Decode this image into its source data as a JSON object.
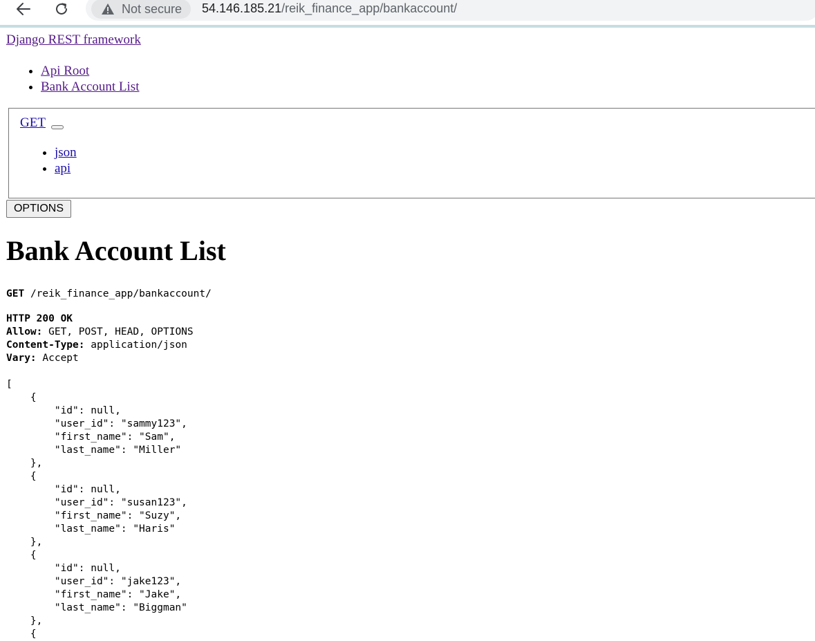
{
  "browser": {
    "security_label": "Not secure",
    "url_host": "54.146.185.21",
    "url_path": "/reik_finance_app/bankaccount/"
  },
  "brand": "Django REST framework",
  "breadcrumbs": [
    "Api Root",
    "Bank Account List"
  ],
  "get_menu": {
    "label": "GET",
    "formats": [
      "json",
      "api"
    ]
  },
  "options_button": "OPTIONS",
  "page_title": "Bank Account List",
  "request": {
    "method": "GET",
    "path": "/reik_finance_app/bankaccount/"
  },
  "response": {
    "status": "HTTP 200 OK",
    "headers": [
      {
        "name": "Allow:",
        "value": "GET, POST, HEAD, OPTIONS"
      },
      {
        "name": "Content-Type:",
        "value": "application/json"
      },
      {
        "name": "Vary:",
        "value": "Accept"
      }
    ],
    "body": "[\n    {\n        \"id\": null,\n        \"user_id\": \"sammy123\",\n        \"first_name\": \"Sam\",\n        \"last_name\": \"Miller\"\n    },\n    {\n        \"id\": null,\n        \"user_id\": \"susan123\",\n        \"first_name\": \"Suzy\",\n        \"last_name\": \"Haris\"\n    },\n    {\n        \"id\": null,\n        \"user_id\": \"jake123\",\n        \"first_name\": \"Jake\",\n        \"last_name\": \"Biggman\"\n    },\n    {"
  }
}
